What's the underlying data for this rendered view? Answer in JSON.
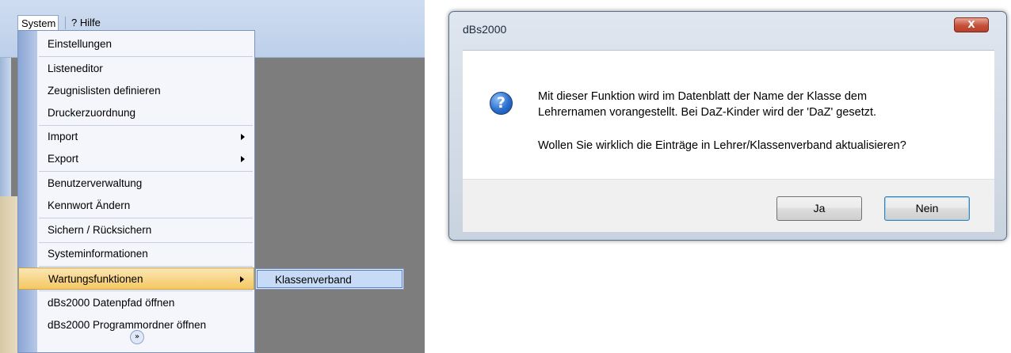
{
  "menubar": {
    "system_label": "System",
    "hilfe_label": "? Hilfe"
  },
  "system_menu": {
    "items": [
      {
        "label": "Einstellungen"
      },
      {
        "label": "Listeneditor"
      },
      {
        "label": "Zeugnislisten definieren"
      },
      {
        "label": "Druckerzuordnung"
      },
      {
        "label": "Import",
        "has_submenu": true
      },
      {
        "label": "Export",
        "has_submenu": true
      },
      {
        "label": "Benutzerverwaltung"
      },
      {
        "label": "Kennwort Ändern"
      },
      {
        "label": "Sichern / Rücksichern"
      },
      {
        "label": "Systeminformationen"
      },
      {
        "label": "Wartungsfunktionen",
        "has_submenu": true,
        "highlighted": true
      },
      {
        "label": "dBs2000 Datenpfad öffnen"
      },
      {
        "label": "dBs2000 Programmordner öffnen"
      }
    ],
    "more_icon": "chevron-double-down-icon",
    "submenu": {
      "items": [
        {
          "label": "Klassenverband"
        }
      ]
    }
  },
  "dialog": {
    "title": "dBs2000",
    "close_label": "X",
    "icon": "question-icon",
    "message_line1": "Mit dieser Funktion wird im Datenblatt der Name der Klasse dem",
    "message_line2": "Lehrernamen vorangestellt. Bei DaZ-Kinder wird der 'DaZ' gesetzt.",
    "question": "Wollen Sie wirklich die Einträge in Lehrer/Klassenverband aktualisieren?",
    "buttons": {
      "yes": "Ja",
      "no": "Nein"
    }
  },
  "colors": {
    "menu_highlight": "#f5c862",
    "menu_gutter": "#8aa6d4",
    "submenu_highlight": "#c7daf6",
    "app_background": "#7d7d7d",
    "close_button": "#c4503a"
  }
}
